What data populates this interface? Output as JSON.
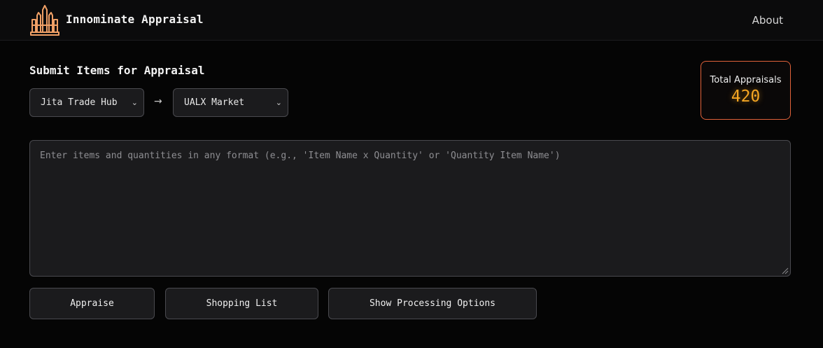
{
  "header": {
    "title": "Innominate Appraisal",
    "about_label": "About",
    "logo_icon": "castle-logo-icon",
    "logo_color": "#f0a066"
  },
  "form": {
    "section_title": "Submit Items for Appraisal",
    "from_market": "Jita Trade Hub",
    "arrow": "→",
    "to_market": "UALX Market",
    "items_placeholder": "Enter items and quantities in any format (e.g., 'Item Name x Quantity' or 'Quantity Item Name')"
  },
  "stats": {
    "label": "Total Appraisals",
    "value": "420",
    "accent_color": "#f5a623",
    "border_color": "#e0623a"
  },
  "actions": {
    "appraise_label": "Appraise",
    "shopping_label": "Shopping List",
    "processing_label": "Show Processing Options"
  }
}
